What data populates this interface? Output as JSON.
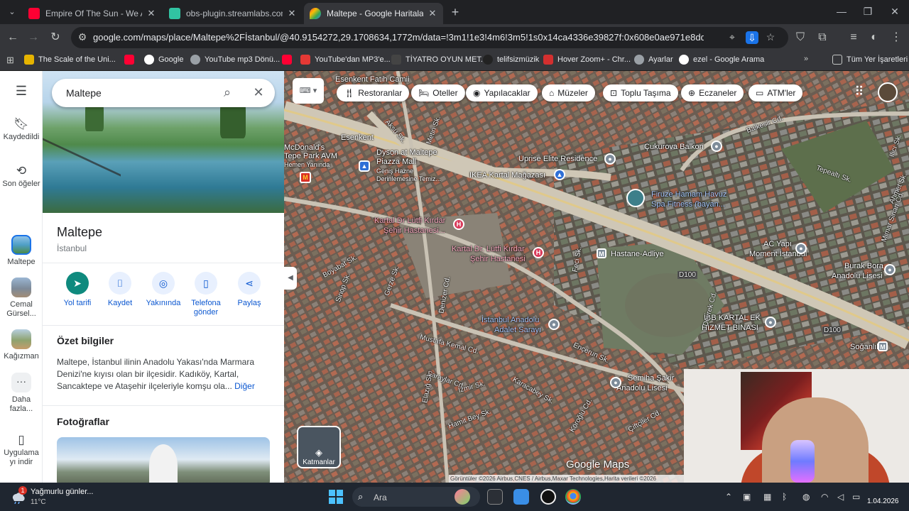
{
  "browser": {
    "tabs": [
      {
        "title": "Empire Of The Sun - We Are Th",
        "icon": "youtube-icon",
        "color": "#ff0033"
      },
      {
        "title": "obs-plugin.streamlabs.com/aut",
        "icon": "streamlabs-icon",
        "color": "#31c3a2"
      },
      {
        "title": "Maltepe - Google Haritalar",
        "icon": "google-maps-icon",
        "color": "#34a853"
      }
    ],
    "url": "google.com/maps/place/Maltepe%2Fİstanbul/@40.9154272,29.1708634,1772m/data=!3m1!1e3!4m6!3m5!1s0x14ca4336e39827f:0x608e0ae971e8ddc2!8m2!3d40.94980...",
    "bookmarks": [
      "The Scale of the Uni...",
      "Google",
      "YouTube mp3 Dönü...",
      "YouTube'dan MP3'e...",
      "TİYATRO OYUN MET...",
      "telifsizmüzik",
      "Hover Zoom+ - Chr...",
      "Ayarlar",
      "ezel - Google Arama"
    ],
    "all_bookmarks": "Tüm Yer İşaretleri"
  },
  "rail": {
    "saved": "Kaydedildi",
    "recent": "Son öğeler",
    "maltepe": "Maltepe",
    "cemal": "Cemal Gürsel...",
    "kagizman": "Kağızman",
    "more": "Daha fazla...",
    "app": "Uygulama yı indir"
  },
  "panel": {
    "search_value": "Maltepe",
    "title": "Maltepe",
    "subtitle": "İstanbul",
    "actions": [
      "Yol tarifi",
      "Kaydet",
      "Yakınında",
      "Telefona gönder",
      "Paylaş"
    ],
    "summary_heading": "Özet bilgiler",
    "summary_text": "Maltepe, İstanbul ilinin Anadolu Yakası'nda Marmara Denizi'ne kıyısı olan bir ilçesidir. Kadıköy, Kartal, Sancaktepe ve Ataşehir ilçeleriyle komşu ola...",
    "more": "Diğer",
    "photos_heading": "Fotoğraflar"
  },
  "map": {
    "chips": [
      "Restoranlar",
      "Oteller",
      "Yapılacaklar",
      "Müzeler",
      "Toplu Taşıma",
      "Eczaneler",
      "ATM'ler"
    ],
    "places": {
      "fatih": "Esenkent Fatih Camii",
      "esenkent": "Esenkent",
      "mcd": "McDonald's",
      "mcd2": "Dyson at Maltepe Piazza AVM",
      "mcd3": "Hemen Yanında",
      "dyson1": "Dyson at Maltepe",
      "dyson2": "Piazza Mall",
      "dyson3": "Geniş Hazne",
      "dyson4": "Derinlemesine Temiz...",
      "ikea": "IKEA Kartal Mağazası",
      "uprise": "Uprise Elite Residence",
      "cukurova": "Çukurova Balkon",
      "firuze1": "Firuze Hamam Havuz",
      "firuze2": "Spa Fitness (bayan...",
      "hosp1a": "Kartal Dr Lütfi Kırdar",
      "hosp1b": "Şehir Hastanesi...",
      "hosp2a": "Kartal Dr. Lütfi Kırdar",
      "hosp2b": "Şehir Hastanesi",
      "hastane": "Hastane-Adliye",
      "ac1": "AC Yapı",
      "ac2": "Moment İstanbul",
      "burak1": "Burak Bora",
      "burak2": "Anadolu Lisesi",
      "adalet1": "İstanbul Anadolu",
      "adalet2": "Adalet Sarayı",
      "ibb1": "İBB KARTAL EK",
      "ibb2": "HİZMET BİNASI",
      "semiha1": "Semiha Şakir",
      "semiha2": "Anadolu Lisesi",
      "soganlik": "Soğanlık",
      "d100a": "D100",
      "d100b": "D100"
    },
    "streets": [
      "Balkesir Cd.",
      "Mimar Sinan Cd.",
      "Mustafa Kemal Cd.",
      "Saraylar Cd.",
      "İzmir Sk.",
      "Hamit Bey Sk.",
      "Köroğlu Cd.",
      "Ençerun Sk.",
      "Çiftçiler Cd.",
      "Devrek Cd.",
      "Denizer Cd.",
      "Aksu Sk.",
      "Metin Sk.",
      "Ahmet Sk.",
      "Tepealtı Sk.",
      "Ilıcı Sk.",
      "Feci Sk.",
      "Boyabat Sk.",
      "Gerze Sk.",
      "Sinop Sk.",
      "Karacabey Sk.",
      "Elazığ Sk."
    ],
    "layers": "Katmanlar",
    "logo": "Google Maps",
    "attribution": "Görüntüler ©2026 Airbus,CNES / Airbus,Maxar Technologies,Harita verileri ©2026"
  },
  "taskbar": {
    "weather_badge": "1",
    "weather_title": "Yağmurlu günler...",
    "weather_temp": "11°C",
    "search": "Ara",
    "date": "1.04.2026"
  }
}
